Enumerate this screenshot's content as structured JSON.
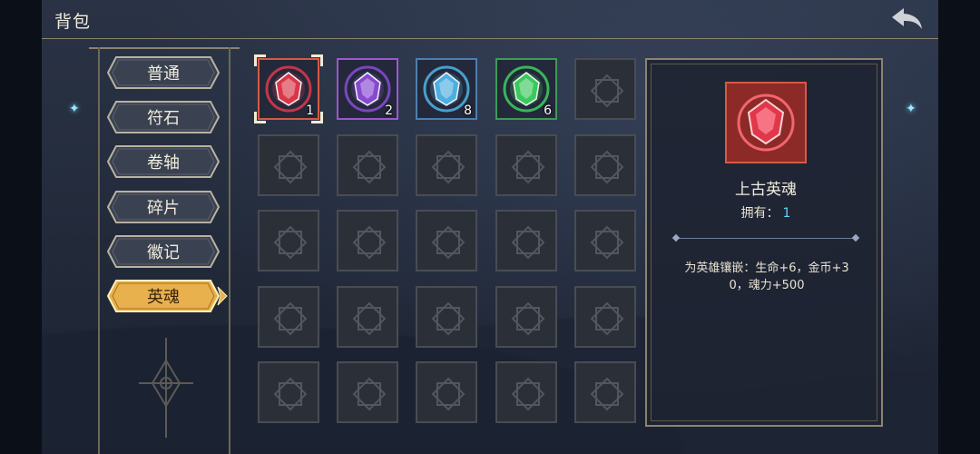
{
  "header": {
    "title": "背包"
  },
  "menu": {
    "items": [
      {
        "label": "普通"
      },
      {
        "label": "符石"
      },
      {
        "label": "卷轴"
      },
      {
        "label": "碎片"
      },
      {
        "label": "徽记"
      },
      {
        "label": "英魂"
      }
    ],
    "active_index": 5
  },
  "inventory": {
    "items": [
      {
        "icon": "red-soul-gem-icon",
        "count": "1",
        "color": "#e0384a",
        "frame": "#d65a44",
        "selected": true
      },
      {
        "icon": "purple-soul-gem-icon",
        "count": "2",
        "color": "#8a4bd6",
        "frame": "#9b57d0",
        "selected": false
      },
      {
        "icon": "blue-soul-gem-icon",
        "count": "8",
        "color": "#4fb4e8",
        "frame": "#4c7fb0",
        "selected": false
      },
      {
        "icon": "green-soul-gem-icon",
        "count": "6",
        "color": "#3ccf5e",
        "frame": "#3f9a58",
        "selected": false
      }
    ],
    "total_slots": 25
  },
  "detail": {
    "name": "上古英魂",
    "own_label": "拥有：",
    "own_count": "1",
    "description": "为英雄镶嵌：生命+6，金币+30，魂力+500"
  }
}
